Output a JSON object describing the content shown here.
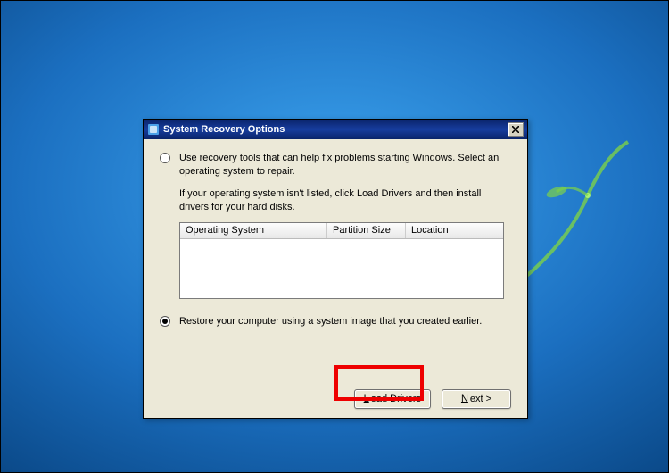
{
  "window": {
    "title": "System Recovery Options",
    "close_label": "×"
  },
  "option1": {
    "text": "Use recovery tools that can help fix problems starting Windows. Select an operating system to repair.",
    "hint": "If your operating system isn't listed, click Load Drivers and then install drivers for your hard disks."
  },
  "table": {
    "col_os": "Operating System",
    "col_partition": "Partition Size",
    "col_location": "Location"
  },
  "option2": {
    "text": "Restore your computer using a system image that you created earlier."
  },
  "buttons": {
    "load_drivers_u": "L",
    "load_drivers_rest": "oad Drivers",
    "next_u": "N",
    "next_rest": "ext >"
  }
}
